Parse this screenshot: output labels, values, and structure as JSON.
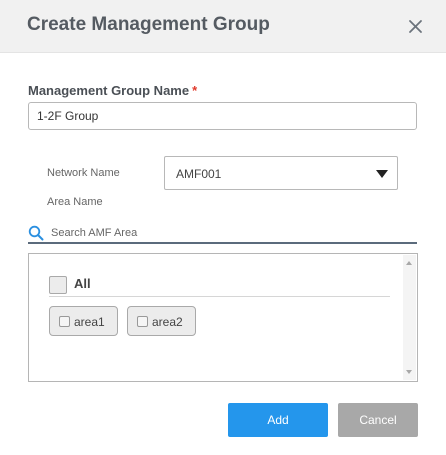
{
  "dialog": {
    "title": "Create Management Group",
    "close_icon": "close-icon"
  },
  "form": {
    "group_name_label": "Management Group Name",
    "required_marker": "*",
    "group_name_value": "1-2F Group",
    "network_name_label": "Network Name",
    "network_selected": "AMF001",
    "area_name_label": "Area Name",
    "search_placeholder": "Search AMF Area",
    "search_icon": "search-icon"
  },
  "area_list": {
    "all_label": "All",
    "items": [
      {
        "label": "area1",
        "checked": false
      },
      {
        "label": "area2",
        "checked": false
      }
    ]
  },
  "buttons": {
    "add": "Add",
    "cancel": "Cancel"
  },
  "colors": {
    "primary": "#2496ec",
    "secondary": "#a8a8a8",
    "required": "#e0392b"
  }
}
